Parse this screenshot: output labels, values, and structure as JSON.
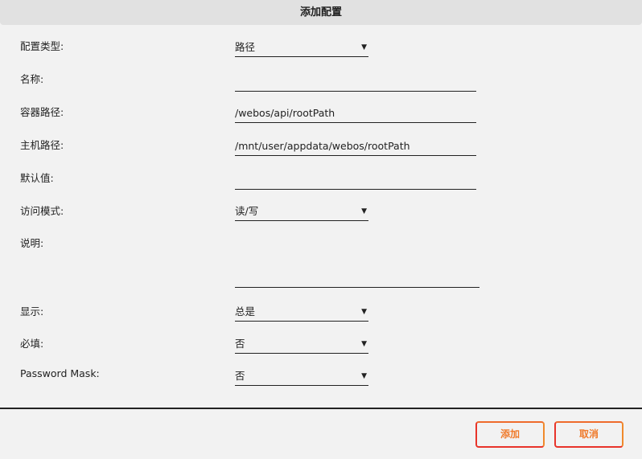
{
  "title": "添加配置",
  "fields": [
    {
      "label": "配置类型:",
      "value": "路径"
    },
    {
      "label": "名称:",
      "value": ""
    },
    {
      "label": "容器路径:",
      "value": "/webos/api/rootPath"
    },
    {
      "label": "主机路径:",
      "value": "/mnt/user/appdata/webos/rootPath"
    },
    {
      "label": "默认值:",
      "value": ""
    },
    {
      "label": "访问模式:",
      "value": "读/写"
    },
    {
      "label": "说明:",
      "value": ""
    },
    {
      "label": "显示:",
      "value": "总是"
    },
    {
      "label": "必填:",
      "value": "否"
    },
    {
      "label": "Password Mask:",
      "value": "否"
    }
  ],
  "arrow": "▼",
  "buttons": {
    "add": "添加",
    "cancel": "取消"
  }
}
